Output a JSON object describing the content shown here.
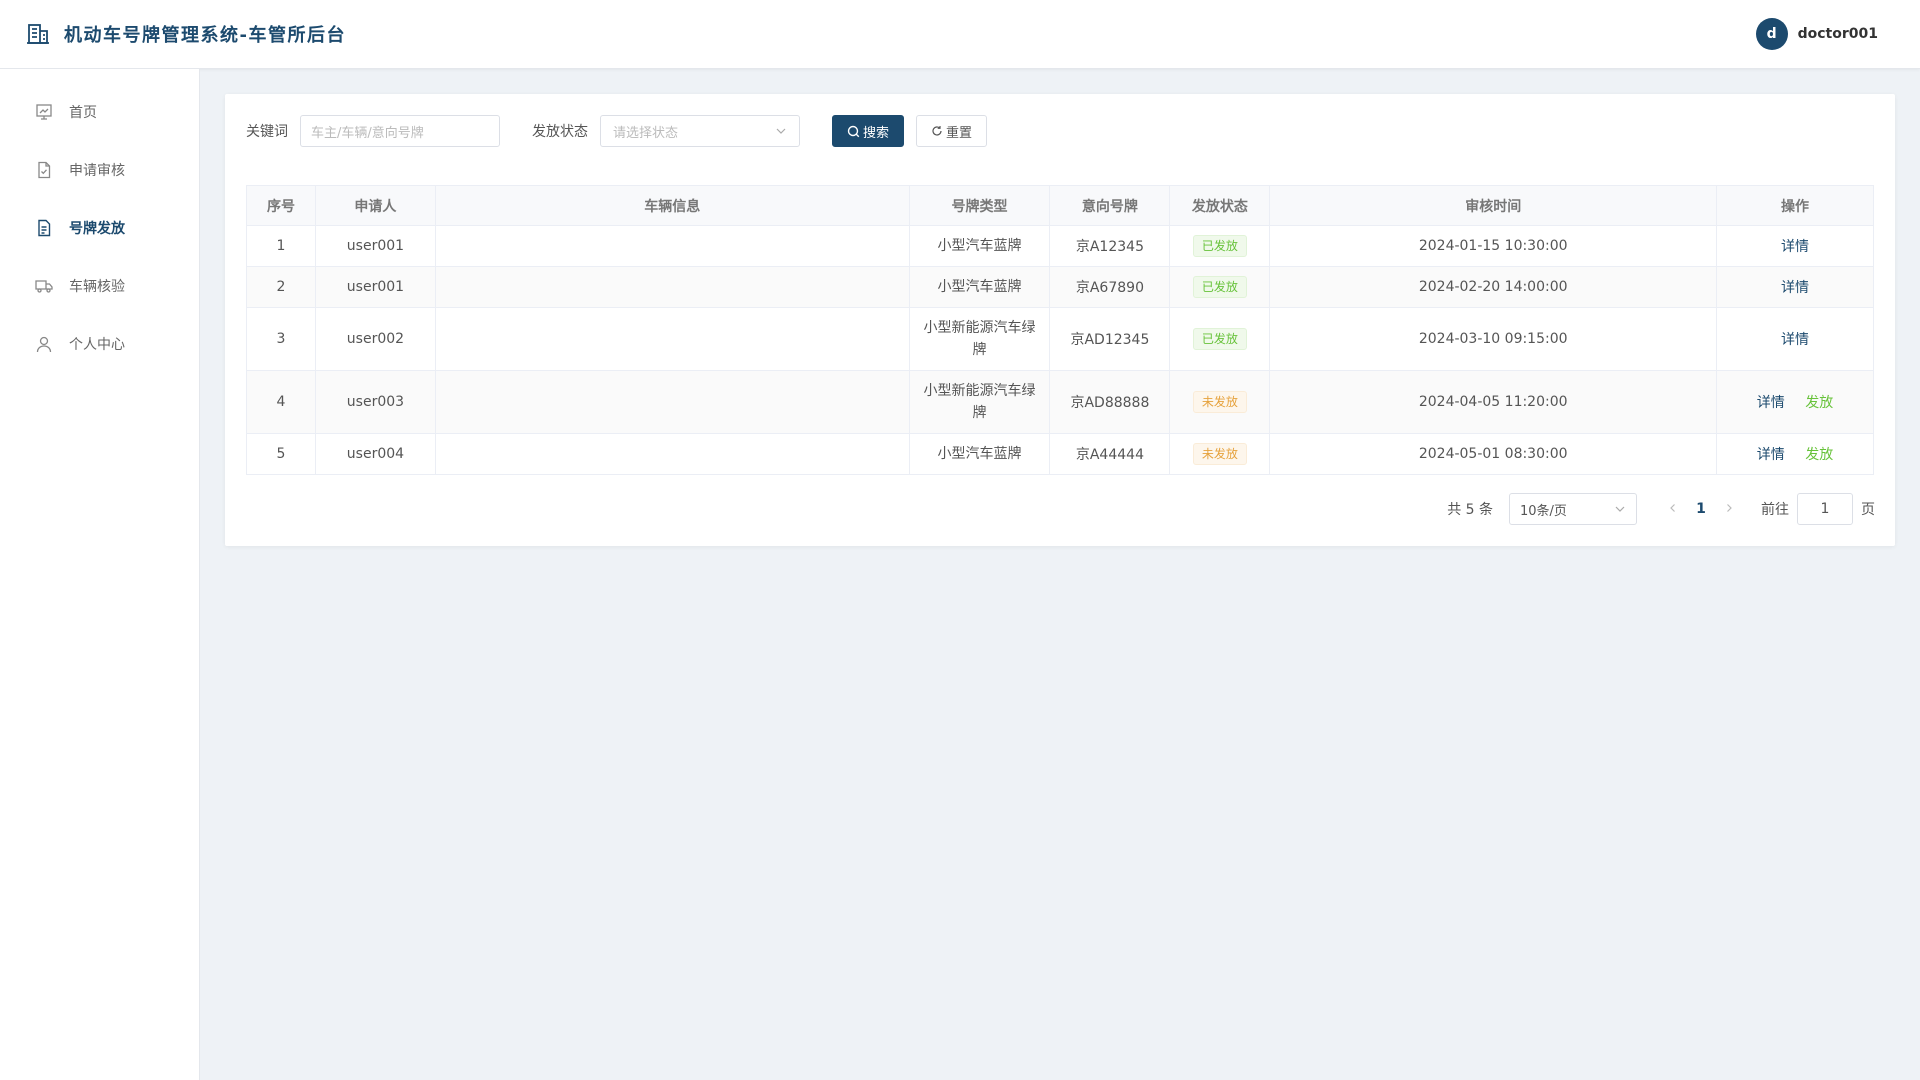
{
  "header": {
    "title": "机动车号牌管理系统-车管所后台",
    "user": {
      "avatar_letter": "d",
      "name": "doctor001"
    }
  },
  "sidebar": {
    "items": [
      {
        "label": "首页",
        "icon": "dashboard-icon"
      },
      {
        "label": "申请审核",
        "icon": "document-check-icon"
      },
      {
        "label": "号牌发放",
        "icon": "document-list-icon",
        "active": true
      },
      {
        "label": "车辆核验",
        "icon": "truck-icon"
      },
      {
        "label": "个人中心",
        "icon": "user-icon"
      }
    ]
  },
  "filters": {
    "keyword_label": "关键词",
    "keyword_placeholder": "车主/车辆/意向号牌",
    "status_label": "发放状态",
    "status_placeholder": "请选择状态",
    "search_label": "搜索",
    "reset_label": "重置"
  },
  "table": {
    "columns": [
      "序号",
      "申请人",
      "车辆信息",
      "号牌类型",
      "意向号牌",
      "发放状态",
      "审核时间",
      "操作"
    ],
    "rows": [
      {
        "index": "1",
        "applicant": "user001",
        "vehicle": "",
        "plate_type": "小型汽车蓝牌",
        "plate": "京A12345",
        "status": "已发放",
        "time": "2024-01-15 10:30:00",
        "actions": [
          "详情"
        ]
      },
      {
        "index": "2",
        "applicant": "user001",
        "vehicle": "",
        "plate_type": "小型汽车蓝牌",
        "plate": "京A67890",
        "status": "已发放",
        "time": "2024-02-20 14:00:00",
        "actions": [
          "详情"
        ]
      },
      {
        "index": "3",
        "applicant": "user002",
        "vehicle": "",
        "plate_type": "小型新能源汽车绿牌",
        "plate": "京AD12345",
        "status": "已发放",
        "time": "2024-03-10 09:15:00",
        "actions": [
          "详情"
        ]
      },
      {
        "index": "4",
        "applicant": "user003",
        "vehicle": "",
        "plate_type": "小型新能源汽车绿牌",
        "plate": "京AD88888",
        "status": "未发放",
        "time": "2024-04-05 11:20:00",
        "actions": [
          "详情",
          "发放"
        ]
      },
      {
        "index": "5",
        "applicant": "user004",
        "vehicle": "",
        "plate_type": "小型汽车蓝牌",
        "plate": "京A44444",
        "status": "未发放",
        "time": "2024-05-01 08:30:00",
        "actions": [
          "详情",
          "发放"
        ]
      }
    ]
  },
  "pagination": {
    "total_text": "共 5 条",
    "page_size": "10条/页",
    "current_page": "1",
    "goto_label": "前往",
    "goto_value": "1",
    "page_suffix": "页"
  },
  "colors": {
    "primary": "#1c4a6e",
    "success": "#67c23a",
    "warning": "#e6a23c"
  }
}
